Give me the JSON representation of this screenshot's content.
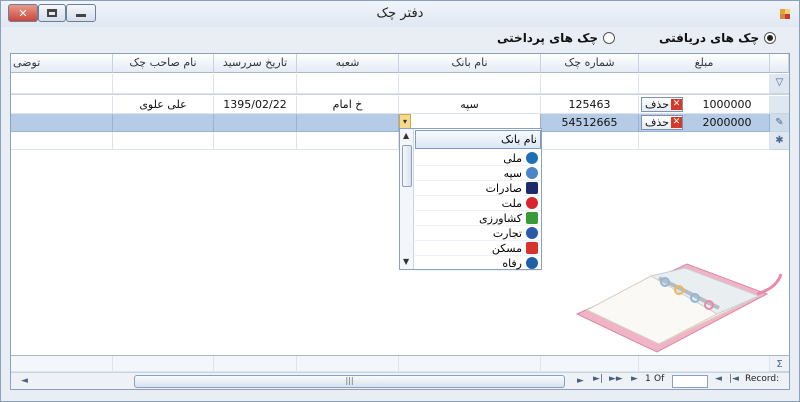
{
  "window": {
    "title": "دفتر چک",
    "close_glyph": "✕"
  },
  "radios": {
    "received": {
      "label": "چک های دریافتی",
      "checked": true
    },
    "paid": {
      "label": "چک های پرداختی",
      "checked": false
    }
  },
  "columns": [
    "مبلغ",
    "شماره چک",
    "نام بانک",
    "شعبه",
    "تاریخ سررسید",
    "نام صاحب چک",
    "توضی"
  ],
  "rows": [
    {
      "delete_label": "حذف",
      "amount": "1000000",
      "check_number": "125463",
      "bank": "سپه",
      "branch": "خ امام",
      "due_date": "1395/02/22",
      "owner": "علی علوی",
      "note": ""
    },
    {
      "delete_label": "حذف",
      "amount": "2000000",
      "check_number": "54512665",
      "bank": "",
      "branch": "",
      "due_date": "",
      "owner": "",
      "note": ""
    }
  ],
  "bank_dropdown": {
    "header": "نام بانک",
    "items": [
      {
        "label": "ملی",
        "icon": "bank-melli-icon",
        "color": "#1e6fb3"
      },
      {
        "label": "سپه",
        "icon": "bank-sepah-icon",
        "color": "#4c86c6"
      },
      {
        "label": "صادرات",
        "icon": "bank-saderat-icon",
        "color": "#1d2b6b"
      },
      {
        "label": "ملت",
        "icon": "bank-mellat-icon",
        "color": "#d7262e"
      },
      {
        "label": "کشاورزی",
        "icon": "bank-keshavarzi-icon",
        "color": "#3a9a3a"
      },
      {
        "label": "تجارت",
        "icon": "bank-tejarat-icon",
        "color": "#2a5aa8"
      },
      {
        "label": "مسکن",
        "icon": "bank-maskan-icon",
        "color": "#d8322b"
      },
      {
        "label": "رفاه",
        "icon": "bank-refah-icon",
        "color": "#1f5fa8"
      }
    ]
  },
  "pager": {
    "page": "1",
    "of_label": "Of",
    "record_label": "Record:",
    "summary_glyph": "Σ",
    "grip_glyph": "|||"
  },
  "glyphs": {
    "filter": "▽",
    "edit": "✎",
    "new": "✱",
    "dropdown": "▾",
    "up": "▲",
    "down": "▼",
    "left": "◄",
    "right": "►"
  }
}
